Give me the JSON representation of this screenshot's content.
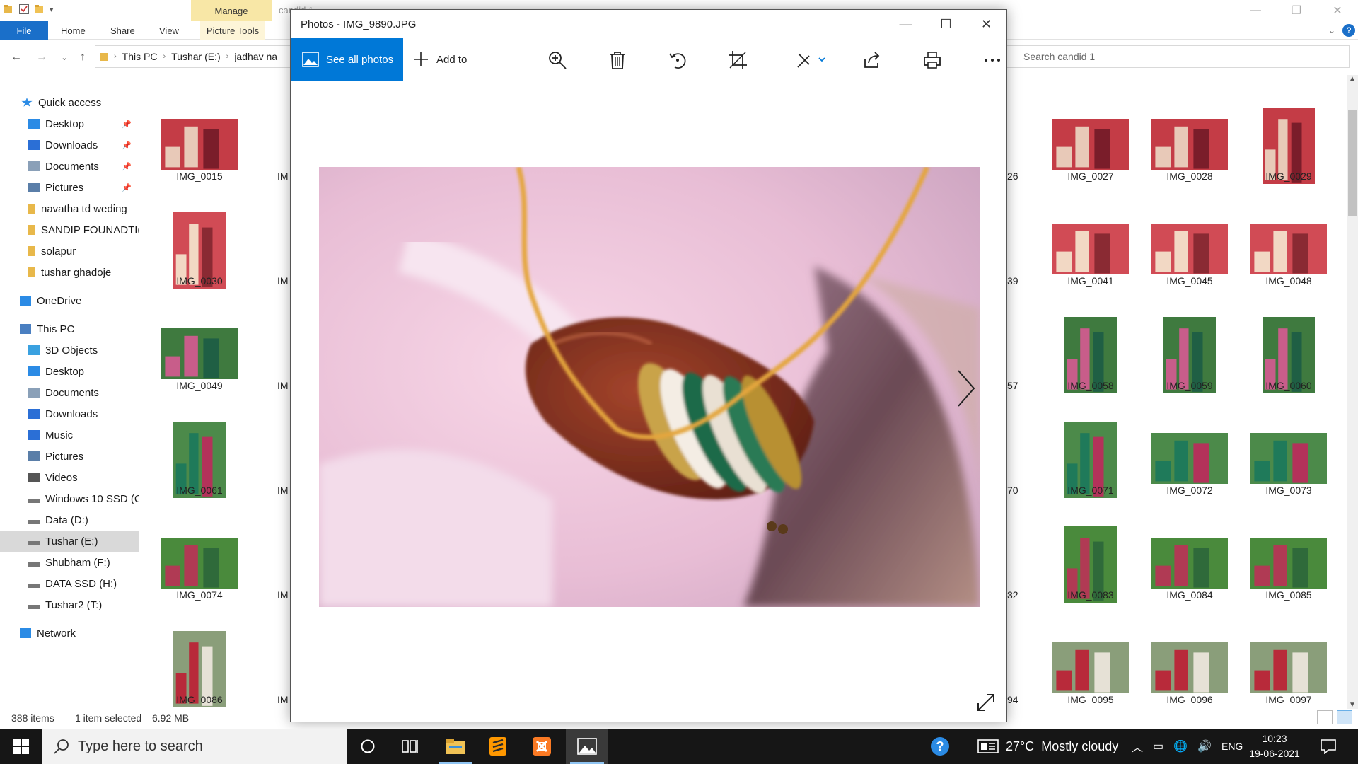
{
  "explorer": {
    "folder_title": "candid 1",
    "manage_tab": "Manage",
    "ribbon_tabs": [
      "File",
      "Home",
      "Share",
      "View",
      "Picture Tools"
    ],
    "breadcrumb": [
      "This PC",
      "Tushar (E:)",
      "jadhav na"
    ],
    "search_placeholder": "Search candid 1",
    "sidebar": [
      {
        "label": "Quick access",
        "icon": "star-icon"
      },
      {
        "label": "Desktop",
        "icon": "desktop-icon",
        "pinned": true
      },
      {
        "label": "Downloads",
        "icon": "download-icon",
        "pinned": true
      },
      {
        "label": "Documents",
        "icon": "document-icon",
        "pinned": true
      },
      {
        "label": "Pictures",
        "icon": "pictures-icon",
        "pinned": true
      },
      {
        "label": "navatha td weding",
        "icon": "folder-icon"
      },
      {
        "label": "SANDIP FOUNADTI(",
        "icon": "folder-icon"
      },
      {
        "label": "solapur",
        "icon": "folder-icon"
      },
      {
        "label": "tushar ghadoje",
        "icon": "folder-icon"
      },
      {
        "label": "OneDrive",
        "icon": "cloud-icon"
      },
      {
        "label": "This PC",
        "icon": "computer-icon"
      },
      {
        "label": "3D Objects",
        "icon": "cube-icon"
      },
      {
        "label": "Desktop",
        "icon": "desktop-icon"
      },
      {
        "label": "Documents",
        "icon": "document-icon"
      },
      {
        "label": "Downloads",
        "icon": "download-icon"
      },
      {
        "label": "Music",
        "icon": "music-icon"
      },
      {
        "label": "Pictures",
        "icon": "pictures-icon"
      },
      {
        "label": "Videos",
        "icon": "video-icon"
      },
      {
        "label": "Windows 10 SSD (C",
        "icon": "drive-icon"
      },
      {
        "label": "Data (D:)",
        "icon": "drive-icon"
      },
      {
        "label": "Tushar (E:)",
        "icon": "drive-icon",
        "selected": true
      },
      {
        "label": "Shubham (F:)",
        "icon": "drive-icon"
      },
      {
        "label": "DATA SSD (H:)",
        "icon": "drive-icon"
      },
      {
        "label": "Tushar2 (T:)",
        "icon": "drive-icon"
      },
      {
        "label": "Network",
        "icon": "network-icon"
      }
    ],
    "thumbnails_left": [
      "IMG_0015",
      "IMG_0030",
      "IMG_0049",
      "IMG_0061",
      "IMG_0074",
      "IMG_0086"
    ],
    "left_partial": [
      "IM",
      "IM",
      "IM",
      "IM",
      "IM",
      "IM"
    ],
    "right_partial": [
      "26",
      "39",
      "57",
      "70",
      "32",
      "94"
    ],
    "thumbnails_right": [
      [
        "IMG_0027",
        "IMG_0028",
        "IMG_0029"
      ],
      [
        "IMG_0041",
        "IMG_0045",
        "IMG_0048"
      ],
      [
        "IMG_0058",
        "IMG_0059",
        "IMG_0060"
      ],
      [
        "IMG_0071",
        "IMG_0072",
        "IMG_0073"
      ],
      [
        "IMG_0083",
        "IMG_0084",
        "IMG_0085"
      ],
      [
        "IMG_0095",
        "IMG_0096",
        "IMG_0097"
      ]
    ],
    "status": {
      "items": "388 items",
      "selected": "1 item selected",
      "size": "6.92 MB"
    }
  },
  "photos": {
    "title": "Photos - IMG_9890.JPG",
    "see_all_label": "See all photos",
    "add_to_label": "Add to"
  },
  "taskbar": {
    "search_placeholder": "Type here to search",
    "weather": "27°C  Mostly cloudy",
    "language": "ENG",
    "time": "10:23",
    "date": "19-06-2021"
  },
  "colors": {
    "accent": "#0078d7",
    "file_tab": "#1a6fc9",
    "manage_tab": "#f8e7a6"
  }
}
